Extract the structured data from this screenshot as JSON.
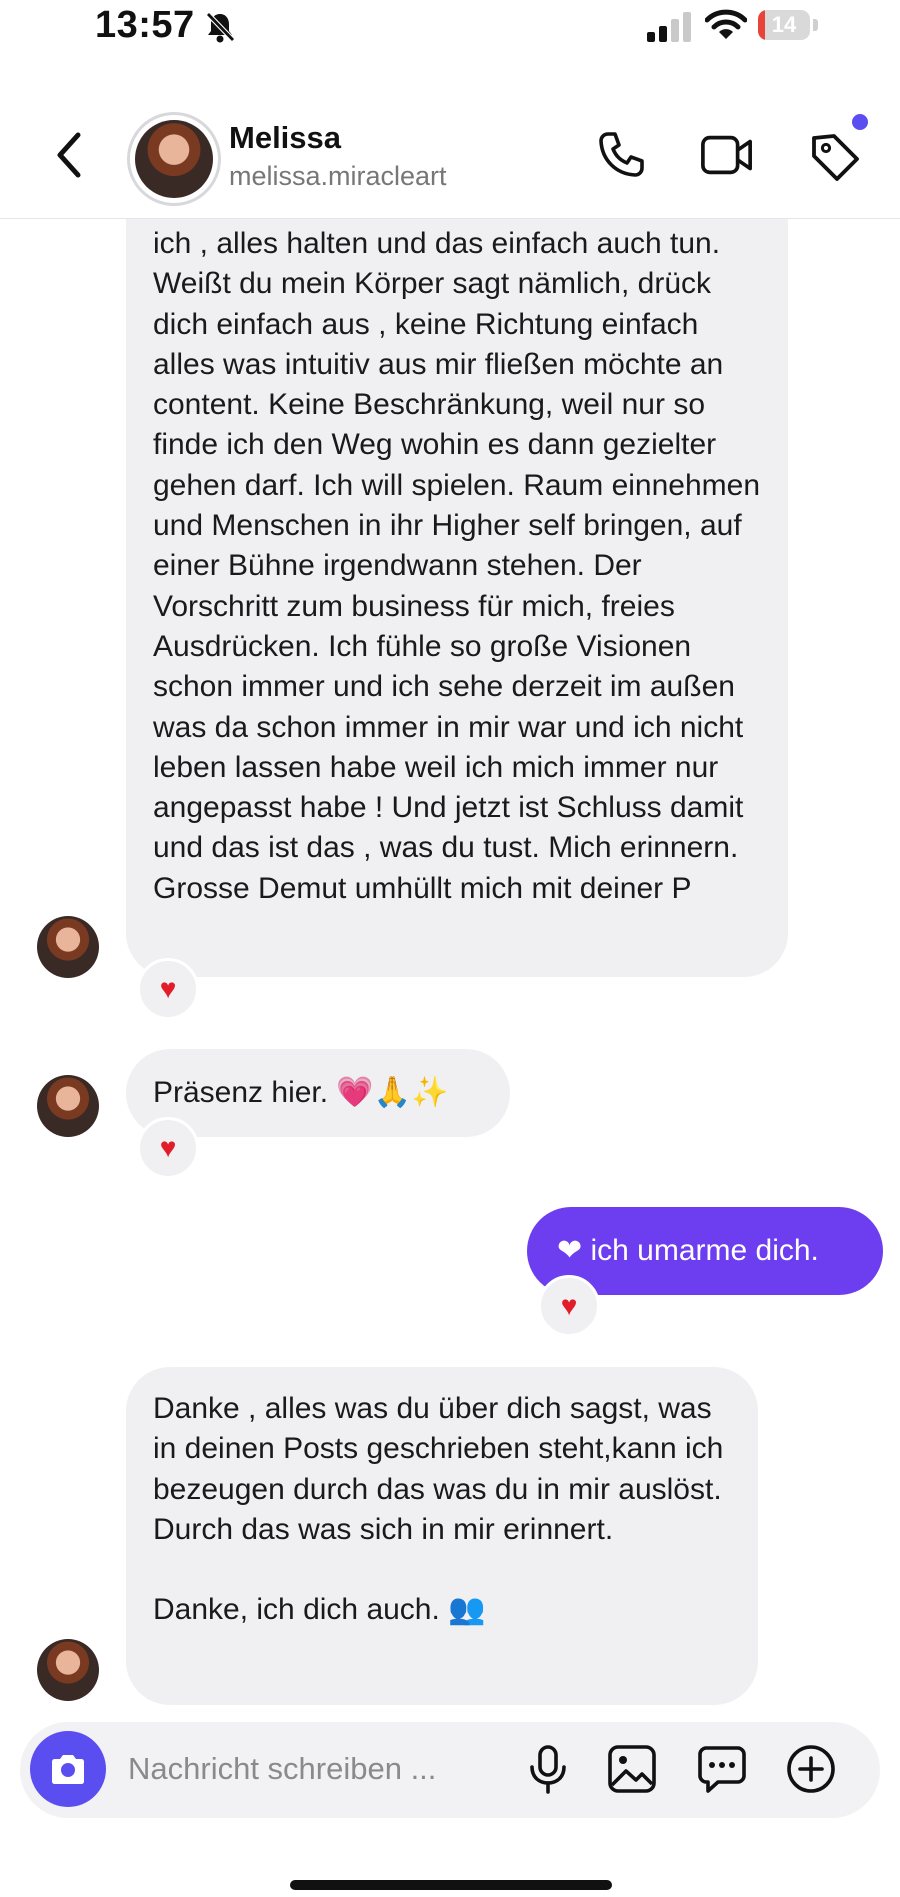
{
  "status_bar": {
    "time": "13:57",
    "battery": 14,
    "icons": [
      "bell-slash-icon",
      "signal-icon",
      "wifi-icon",
      "battery-icon"
    ]
  },
  "header": {
    "name": "Melissa",
    "handle": "melissa.miracleart",
    "icons": [
      "back-chevron-icon",
      "phone-icon",
      "video-icon",
      "tag-icon"
    ]
  },
  "messages": [
    {
      "sender": "contact",
      "text": "ich , alles halten und das einfach auch tun. Weißt du mein Körper sagt nämlich, drück dich einfach aus , keine Richtung einfach alles was intuitiv aus mir fließen möchte an content. Keine Beschränkung, weil nur so finde ich den Weg wohin es dann gezielter gehen darf. Ich will spielen. Raum einnehmen und Menschen in ihr Higher self bringen, auf einer Bühne irgendwann stehen. Der Vorschritt zum business für mich, freies Ausdrücken. Ich fühle so große Visionen schon immer und ich sehe derzeit im außen was da schon immer in mir war und ich nicht leben lassen habe weil ich mich immer nur angepasst habe ! Und jetzt ist Schluss damit und das ist das , was du tust. Mich erinnern. Grosse Demut umhüllt mich mit deiner P",
      "reaction": "♥"
    },
    {
      "sender": "contact",
      "text": "Präsenz hier. 💗🙏✨",
      "reaction": "♥"
    },
    {
      "sender": "me",
      "text": "❤ ich umarme dich.",
      "reaction": "♥"
    },
    {
      "sender": "contact",
      "text": "Danke , alles was du über dich sagst, was in deinen Posts geschrieben steht,kann ich bezeugen durch das was du in mir auslöst. Durch das was sich in mir erinnert.\n\nDanke, ich dich auch. 👥",
      "reaction": ""
    }
  ],
  "composer": {
    "placeholder": "Nachricht schreiben ...",
    "icons": [
      "camera-icon",
      "microphone-icon",
      "image-icon",
      "chat-bubble-icon",
      "plus-circle-icon"
    ]
  },
  "colors": {
    "accent": "#5b4ef0",
    "outgoing_bubble": "#6c3ef0",
    "incoming_bubble": "#f0f0f3",
    "heart": "#e11d2a"
  }
}
